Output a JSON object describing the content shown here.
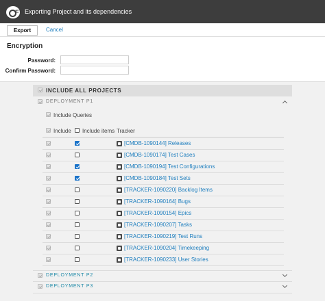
{
  "window": {
    "title": "Exporting Project and its dependencies"
  },
  "toolbar": {
    "export_label": "Export",
    "cancel_label": "Cancel"
  },
  "encryption": {
    "title": "Encryption",
    "password_label": "Password:",
    "password_value": "",
    "confirm_label": "Confirm Password:",
    "confirm_value": ""
  },
  "projects": {
    "include_all_label": "INCLUDE ALL PROJECTS",
    "deployments": [
      {
        "label": "DEPLOYMENT P1",
        "expanded": true
      },
      {
        "label": "DEPLOYMENT P2",
        "expanded": false
      },
      {
        "label": "DEPLOYMENT P3",
        "expanded": false
      }
    ],
    "include_queries_label": "Include Queries",
    "columns": {
      "include": "Include",
      "include_items": "Include items",
      "tracker": "Tracker"
    },
    "trackers": [
      {
        "name": "[CMDB-1090144] Releases",
        "items_checked": true,
        "icon": "releases-icon"
      },
      {
        "name": "[CMDB-1090174] Test Cases",
        "items_checked": false,
        "icon": "test-cases-icon"
      },
      {
        "name": "[CMDB-1090194] Test Configurations",
        "items_checked": true,
        "icon": "test-configurations-icon"
      },
      {
        "name": "[CMDB-1090184] Test Sets",
        "items_checked": true,
        "icon": "test-sets-icon"
      },
      {
        "name": "[TRACKER-1090220] Backlog Items",
        "items_checked": false,
        "icon": "backlog-items-icon"
      },
      {
        "name": "[TRACKER-1090164] Bugs",
        "items_checked": false,
        "icon": "bugs-icon"
      },
      {
        "name": "[TRACKER-1090154] Epics",
        "items_checked": false,
        "icon": "epics-icon"
      },
      {
        "name": "[TRACKER-1090207] Tasks",
        "items_checked": false,
        "icon": "tasks-icon"
      },
      {
        "name": "[TRACKER-1090219] Test Runs",
        "items_checked": false,
        "icon": "test-runs-icon"
      },
      {
        "name": "[TRACKER-1090204] Timekeeping",
        "items_checked": false,
        "icon": "timekeeping-icon"
      },
      {
        "name": "[TRACKER-1090233] User Stories",
        "items_checked": false,
        "icon": "user-stories-icon"
      }
    ]
  },
  "colors": {
    "titlebar": "#3d3d3d",
    "link": "#1f7fbf",
    "checkbox_checked": "#1a73c9",
    "deployment_label": "#1f8aa8"
  }
}
